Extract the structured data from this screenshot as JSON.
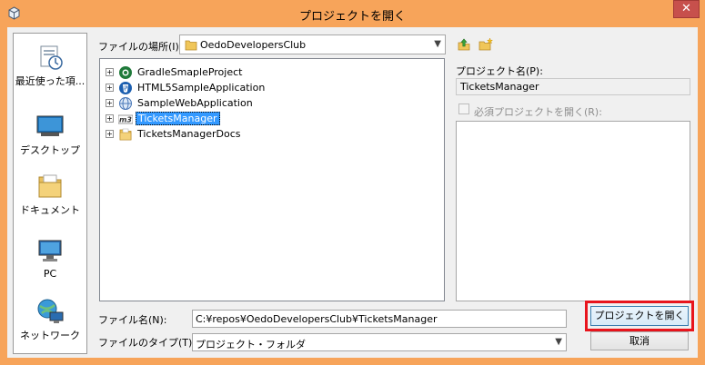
{
  "window": {
    "title": "プロジェクトを開く",
    "close_label": "✕"
  },
  "places": [
    {
      "label": "最近使った項...",
      "icon": "recent-items-icon"
    },
    {
      "label": "デスクトップ",
      "icon": "desktop-icon"
    },
    {
      "label": "ドキュメント",
      "icon": "documents-icon"
    },
    {
      "label": "PC",
      "icon": "pc-icon"
    },
    {
      "label": "ネットワーク",
      "icon": "network-icon"
    }
  ],
  "location": {
    "label": "ファイルの場所(I):",
    "value": "OedoDevelopersClub"
  },
  "tree": [
    {
      "label": "GradleSmapleProject",
      "icon": "gradle-project-icon",
      "selected": false
    },
    {
      "label": "HTML5SampleApplication",
      "icon": "html5-project-icon",
      "selected": false
    },
    {
      "label": "SampleWebApplication",
      "icon": "web-project-icon",
      "selected": false
    },
    {
      "label": "TicketsManager",
      "icon": "maven-project-icon",
      "selected": true
    },
    {
      "label": "TicketsManagerDocs",
      "icon": "folder-icon",
      "selected": false
    }
  ],
  "project_name": {
    "label": "プロジェクト名(P):",
    "value": "TicketsManager"
  },
  "required_projects": {
    "label": "必須プロジェクトを開く(R):"
  },
  "filename": {
    "label": "ファイル名(N):",
    "value": "C:¥repos¥OedoDevelopersClub¥TicketsManager"
  },
  "filetype": {
    "label": "ファイルのタイプ(T):",
    "value": "プロジェクト・フォルダ"
  },
  "buttons": {
    "open": "プロジェクトを開く",
    "cancel": "取消"
  },
  "colors": {
    "title_bar": "#f7a45a",
    "selection": "#3399ff",
    "highlight": "#e8141c"
  }
}
